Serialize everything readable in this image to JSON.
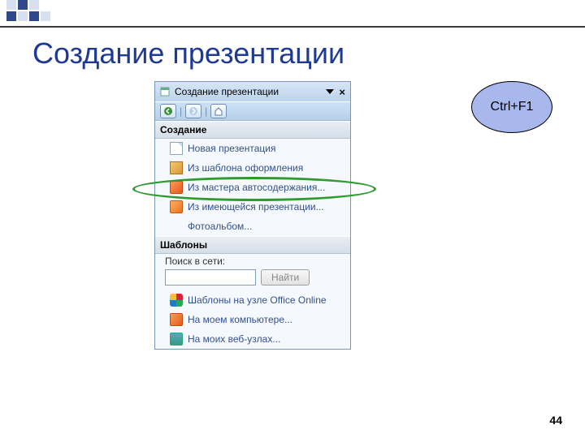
{
  "slide": {
    "title": "Создание презентации",
    "page_number": "44"
  },
  "shortcut": {
    "label": "Ctrl+F1"
  },
  "taskpane": {
    "title": "Создание презентации",
    "sections": {
      "create": {
        "header": "Создание",
        "items": [
          {
            "label": "Новая презентация"
          },
          {
            "label": "Из шаблона оформления"
          },
          {
            "label": "Из мастера автосодержания..."
          },
          {
            "label": "Из имеющейся презентации..."
          },
          {
            "label": "Фотоальбом..."
          }
        ]
      },
      "templates": {
        "header": "Шаблоны",
        "search_label": "Поиск в сети:",
        "search_button": "Найти",
        "items": [
          {
            "label": "Шаблоны на узле Office Online"
          },
          {
            "label": "На моем компьютере..."
          },
          {
            "label": "На моих веб-узлах..."
          }
        ]
      }
    }
  }
}
